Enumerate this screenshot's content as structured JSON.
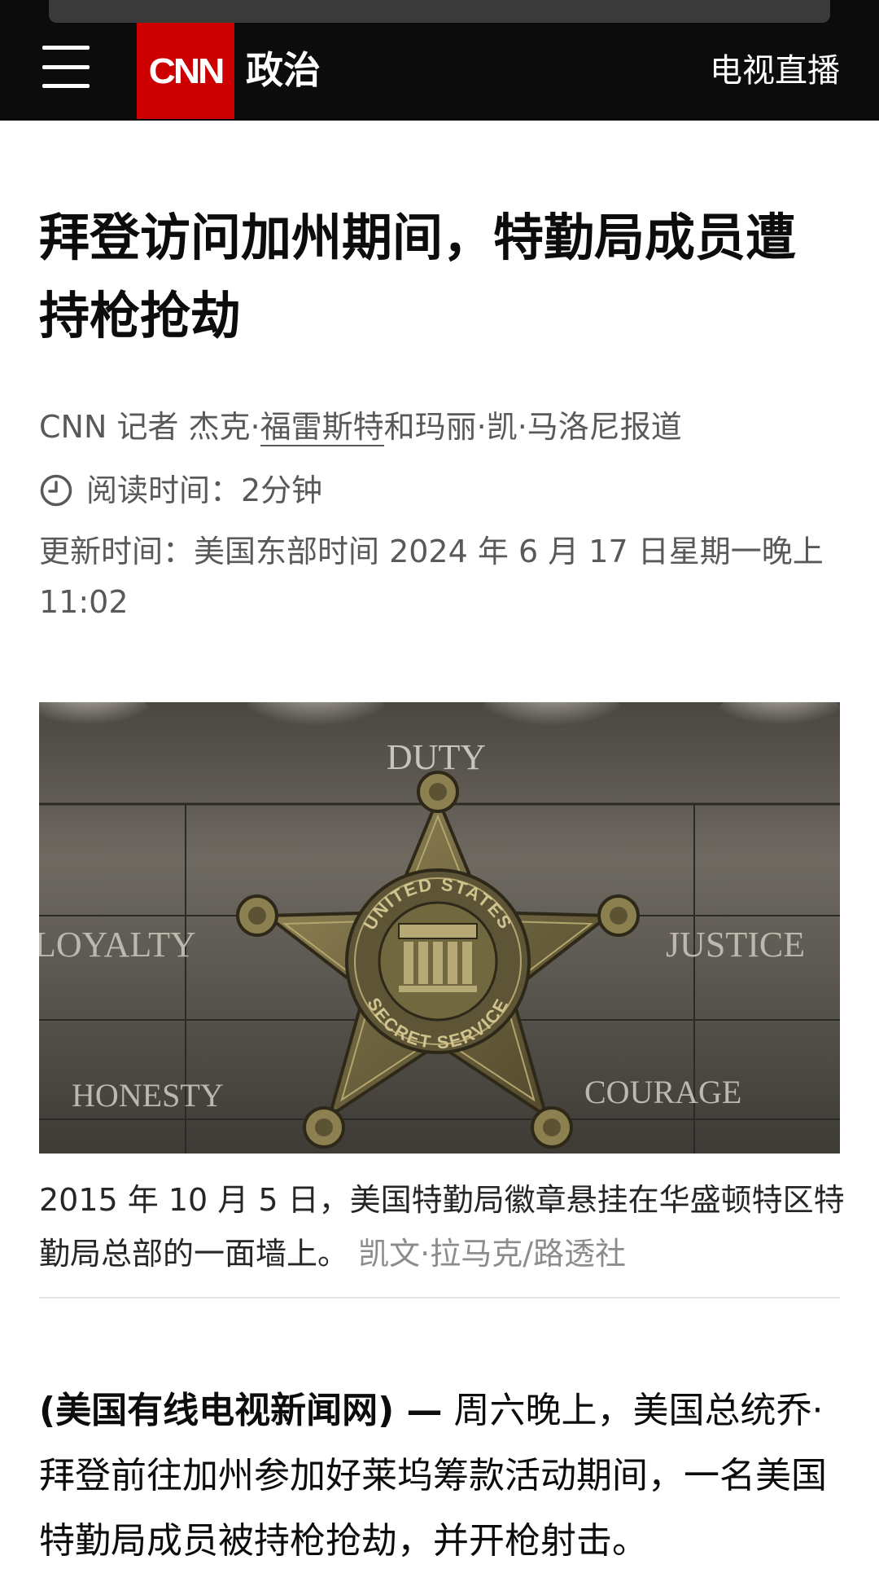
{
  "header": {
    "logo_text": "CNN",
    "section": "政治",
    "live_tv": "电视直播"
  },
  "article": {
    "headline": "拜登访问加州期间，特勤局成员遭持枪抢劫",
    "byline": {
      "prefix": "CNN 记者 杰克·",
      "author_link": "福雷斯特",
      "suffix": "和玛丽·凯·马洛尼报道"
    },
    "read_time": "阅读时间：2分钟",
    "updated": "更新时间：美国东部时间 2024 年 6 月 17 日星期一晚上 11:02",
    "image": {
      "words": {
        "top": "DUTY",
        "left": "LOYALTY",
        "right": "JUSTICE",
        "bottom_left": "HONESTY",
        "bottom_right": "COURAGE"
      },
      "badge_ring_top": "UNITED STATES",
      "badge_ring_bottom": "SECRET SERVICE"
    },
    "caption": {
      "text": "2015 年 10 月 5 日，美国特勤局徽章悬挂在华盛顿特区特勤局总部的一面墙上。",
      "credit": "凯文·拉马克/路透社"
    },
    "body": {
      "source": "(美国有线电视新闻网) —",
      "text": " 周六晚上，美国总统乔·拜登前往加州参加好莱坞筹款活动期间，一名美国特勤局成员被持枪抢劫，并开枪射击。"
    }
  },
  "colors": {
    "header_bg": "#0c0c0c",
    "brand_red": "#cc0000",
    "meta_gray": "#595959",
    "credit_gray": "#8c8c8c"
  },
  "icons": [
    "menu-icon",
    "clock-icon"
  ]
}
